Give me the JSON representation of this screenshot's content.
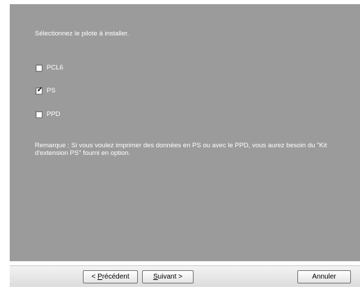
{
  "prompt": "Sélectionnez le pilote à installer.",
  "options": [
    {
      "label": "PCL6",
      "checked": false
    },
    {
      "label": "PS",
      "checked": true
    },
    {
      "label": "PPD",
      "checked": false
    }
  ],
  "remark": "Remarque : Si vous voulez imprimer des données en PS ou avec le PPD, vous aurez besoin du \"Kit d'extension PS\" fourni en option.",
  "buttons": {
    "back_mnemonic": "P",
    "back_rest": "récédent",
    "next_mnemonic": "S",
    "next_rest": "uivant >",
    "cancel": "Annuler"
  },
  "colors": {
    "panel_bg": "#9b9b9b",
    "text": "#ffffff"
  }
}
